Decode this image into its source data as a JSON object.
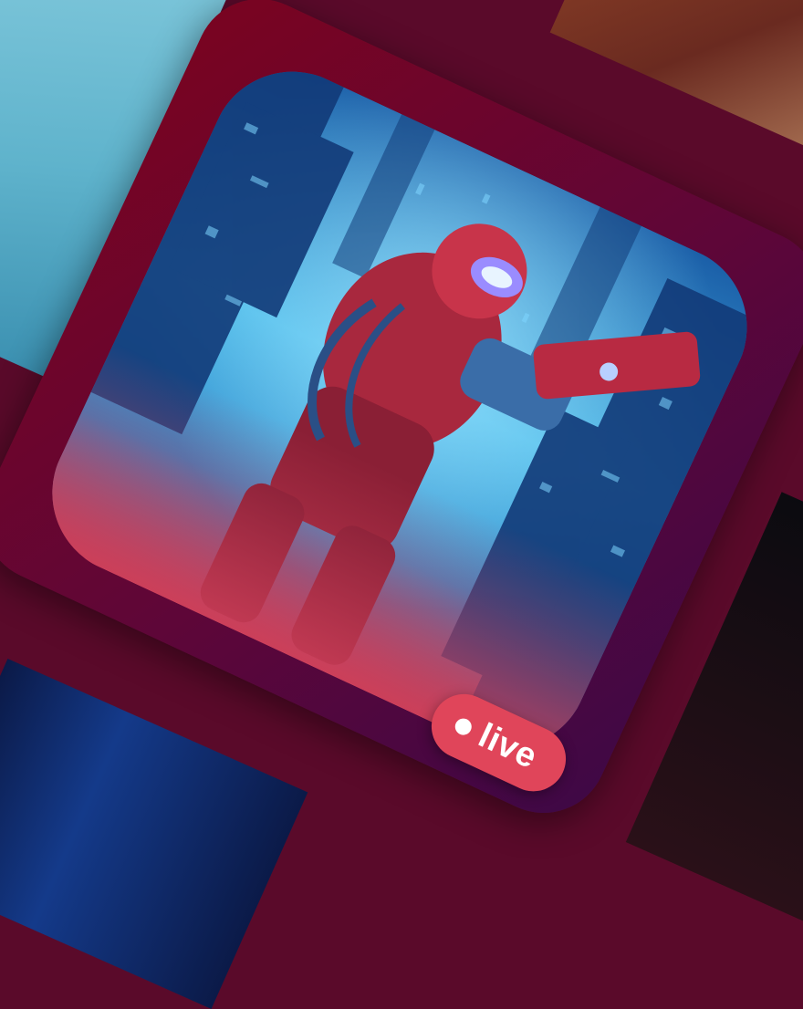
{
  "badge": {
    "label": "live",
    "color": "#e0455a"
  },
  "artwork": {
    "subject": "red-armored-space-soldier-with-blaster",
    "palette": {
      "cyan": "#49b8e8",
      "deep_blue": "#123a78",
      "red": "#c8344a",
      "card_start": "#7a0420",
      "card_end": "#3e0846"
    }
  }
}
